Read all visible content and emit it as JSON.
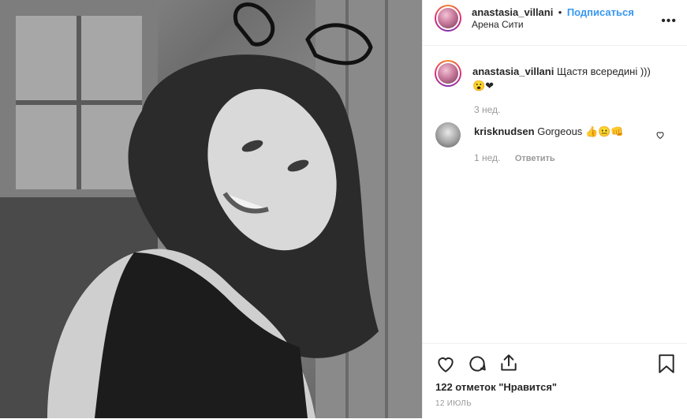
{
  "post": {
    "username": "anastasia_villani",
    "separator": "•",
    "follow_label": "Подписаться",
    "location": "Арена Сити"
  },
  "caption": {
    "username": "anastasia_villani",
    "text": "Щастя всередині )))",
    "emojis": "😮❤",
    "time": "3 нед."
  },
  "comments": [
    {
      "username": "krisknudsen",
      "text": "Gorgeous",
      "emojis": "👍😐👊",
      "time": "1 нед.",
      "reply_label": "Ответить"
    }
  ],
  "footer": {
    "likes": "122 отметок \"Нравится\"",
    "date": "12 ИЮЛЬ"
  },
  "icons": {
    "more": "more-options-icon",
    "like": "heart-icon",
    "comment": "comment-icon",
    "share": "share-icon",
    "save": "bookmark-icon"
  }
}
